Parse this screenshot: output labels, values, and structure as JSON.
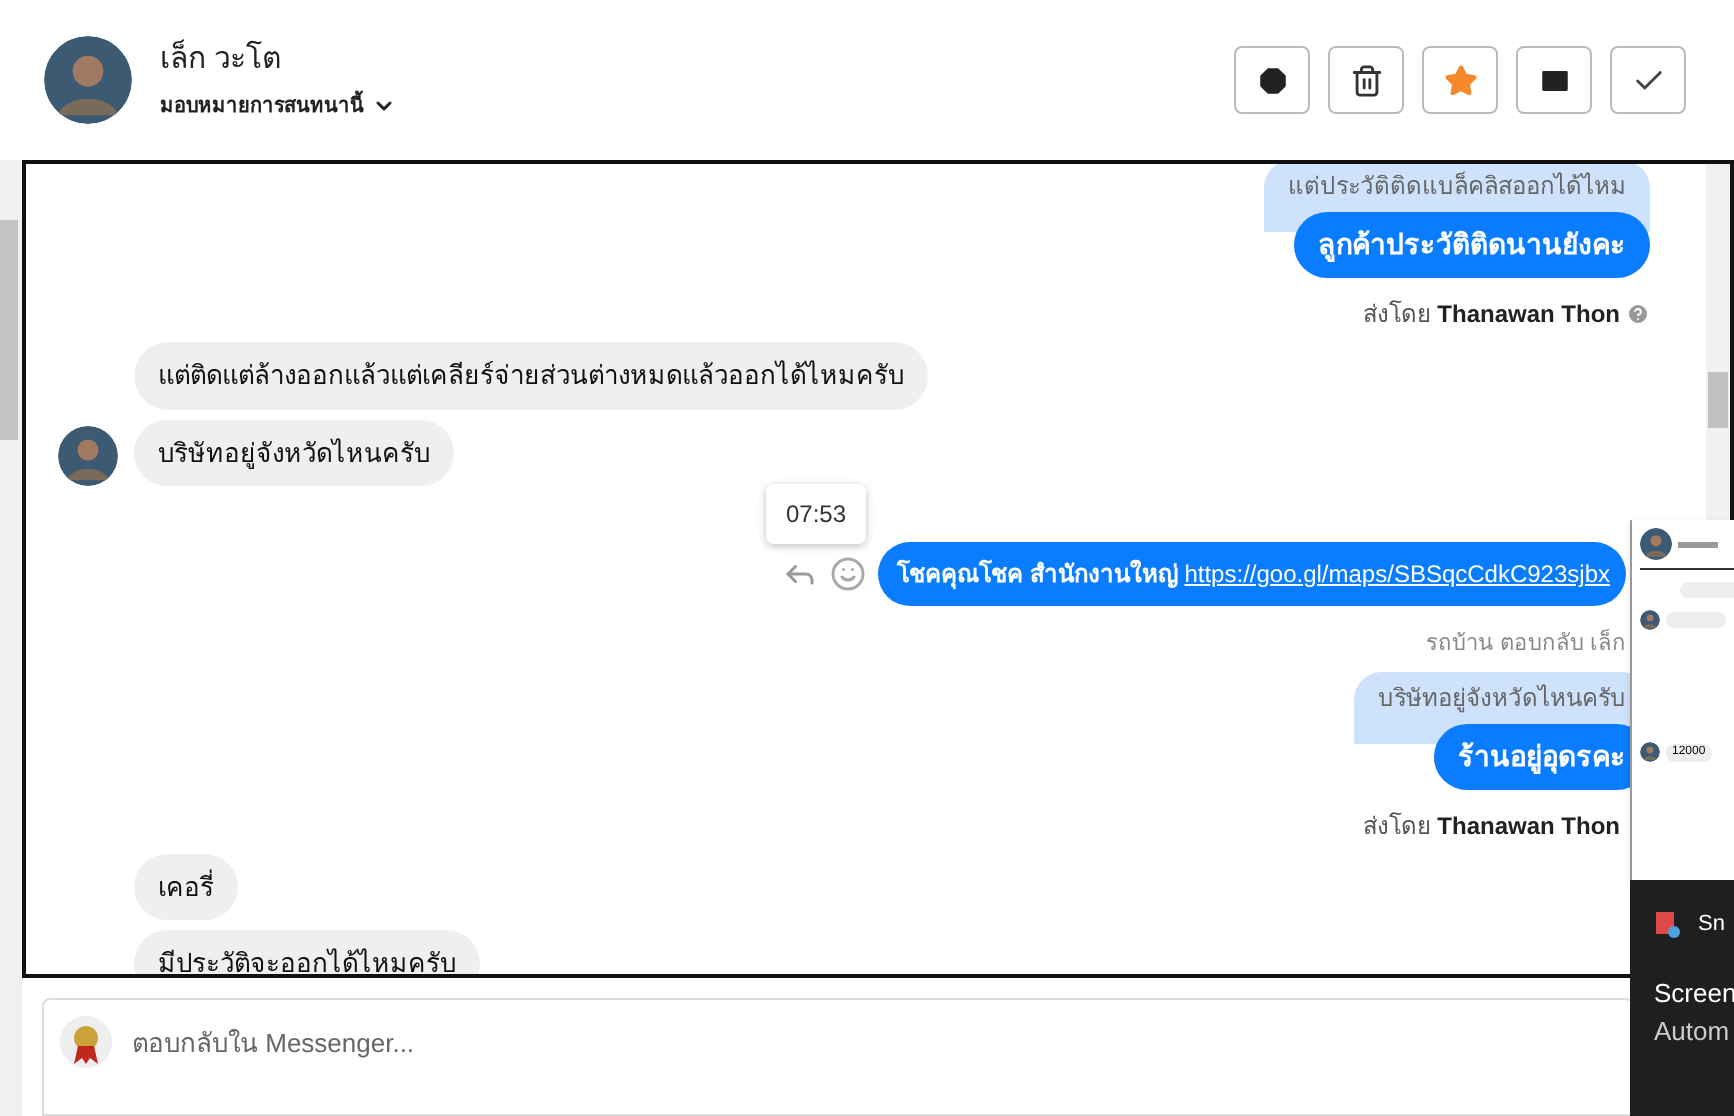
{
  "header": {
    "name": "เล็ก วะโต",
    "assign": "มอบหมายการสนทนานี้",
    "actions": [
      {
        "kind": "alert"
      },
      {
        "kind": "trash"
      },
      {
        "kind": "star"
      },
      {
        "kind": "mail"
      },
      {
        "kind": "check"
      }
    ]
  },
  "messages": [
    {
      "kind": "outgoing",
      "quote": "แต่ประวัติติดแบล็คลิสออกได้ไหม",
      "text": "ลูกค้าประวัติติดนานยังคะ"
    },
    {
      "kind": "sent_by",
      "prefix": "ส่งโดย",
      "sender": "Thanawan Thon",
      "help": true
    },
    {
      "kind": "incoming",
      "text": "แต่ติดแต่ล้างออกแล้วแต่เคลียร์จ่ายส่วนต่างหมดแล้วออกได้ไหมครับ",
      "avatar": false
    },
    {
      "kind": "incoming",
      "text": "บริษัทอยู่จังหวัดไหนครับ",
      "avatar": true
    },
    {
      "kind": "tooltip",
      "text": "07:53"
    },
    {
      "kind": "outgoing_link",
      "text": "โชคคุณโชค สำนักงานใหญ่",
      "link": "https://goo.gl/maps/SBSqcCdkC923sjbx"
    },
    {
      "kind": "reply_label",
      "text": "รถบ้าน ตอบกลับ เล็ก"
    },
    {
      "kind": "outgoing",
      "quote": "บริษัทอยู่จังหวัดไหนครับ",
      "text": "ร้านอยู่อุดรคะ"
    },
    {
      "kind": "sent_by",
      "prefix": "ส่งโดย",
      "sender": "Thanawan Thon",
      "help": false
    },
    {
      "kind": "incoming",
      "text": "เคอรี่",
      "avatar": false
    },
    {
      "kind": "incoming",
      "text": "มีประวัติจะออกได้ไหมครับ",
      "avatar": false
    }
  ],
  "composer": {
    "placeholder": "ตอบกลับใน Messenger..."
  },
  "overlay": {
    "thumbnail_value": "12000",
    "toast_app": "Sn",
    "toast_title": "Screen",
    "toast_body": "Autom"
  }
}
